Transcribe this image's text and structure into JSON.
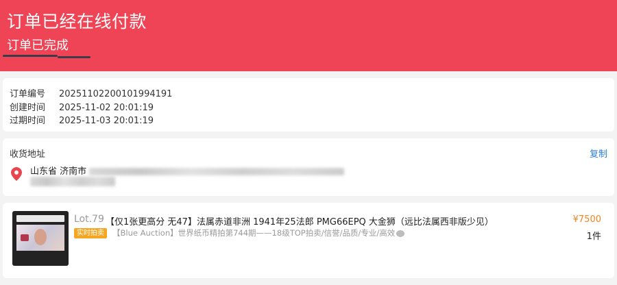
{
  "header": {
    "title": "订单已经在线付款",
    "subtitle": "订单已完成",
    "background": "#ee4455"
  },
  "order_info": {
    "rows": [
      {
        "label": "订单编号",
        "value": "20251102200101994191"
      },
      {
        "label": "创建时间",
        "value": "2025-11-02 20:01:19"
      },
      {
        "label": "过期时间",
        "value": "2025-11-03 20:01:19"
      }
    ]
  },
  "address": {
    "title": "收货地址",
    "copy_label": "复制",
    "visible_text": "山东省 济南市",
    "icon": "location-pin-icon",
    "icon_color": "#e8474f"
  },
  "item": {
    "lot": "Lot.79",
    "title": "【仅1张更高分 无47】法属赤道非洲 1941年25法郎 PMG66EPQ 大金狮（远比法属西非版少见）",
    "tag": "实时拍卖",
    "description": "【Blue Auction】世界纸币精拍第744期——18级TOP拍卖/信誉/品质/专业/高效",
    "price": "¥7500",
    "quantity": "1件",
    "price_color": "#f5821f",
    "tag_color": "#f5a623"
  }
}
